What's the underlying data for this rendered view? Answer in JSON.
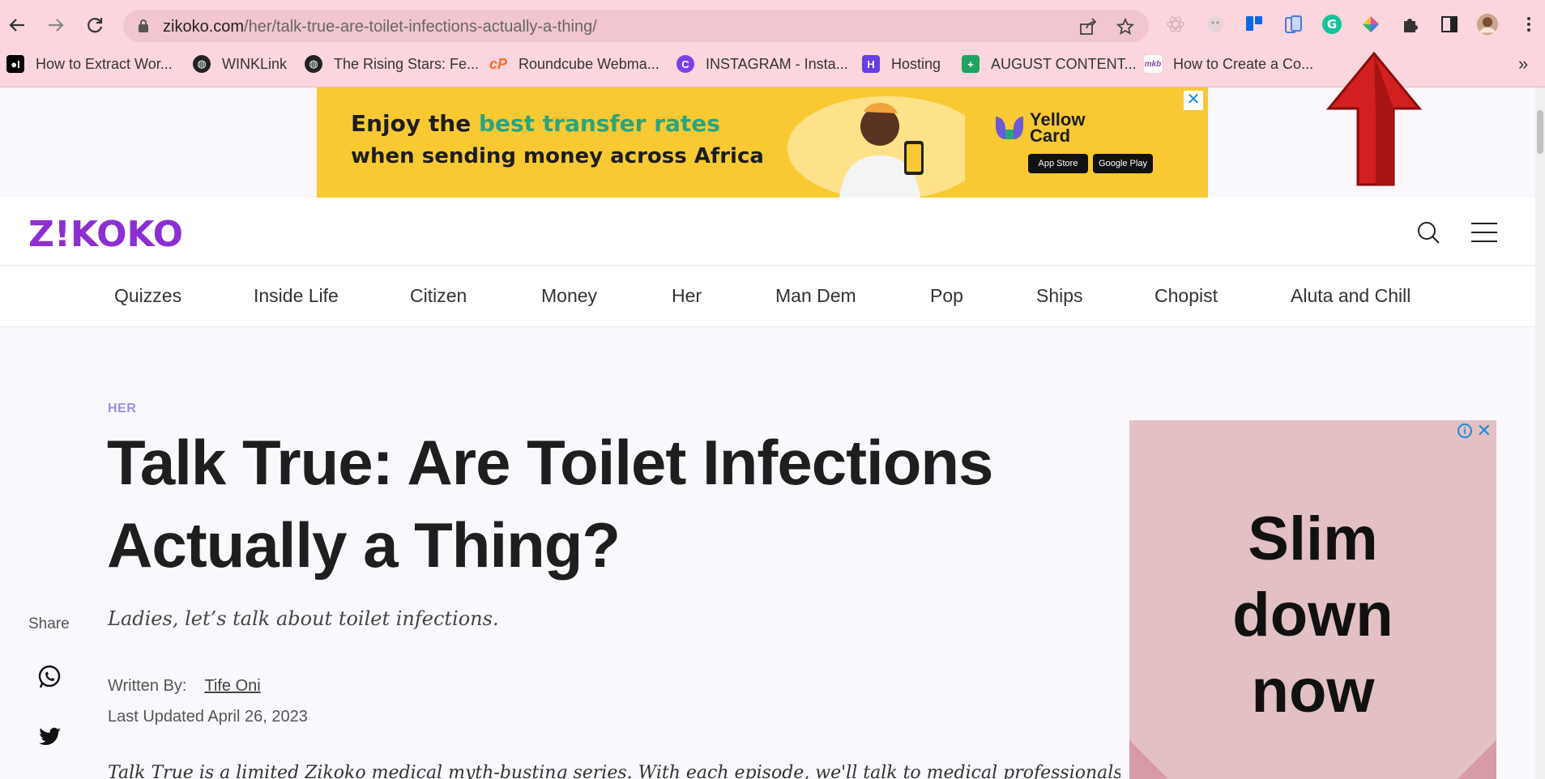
{
  "browser": {
    "url_host": "zikoko.com",
    "url_path": "/her/talk-true-are-toilet-infections-actually-a-thing/",
    "extensions": [
      "react-devtools-icon",
      "ghost-extension-icon",
      "trello-icon",
      "mobile-view-icon",
      "grammarly-icon",
      "color-picker-icon",
      "puzzle-icon",
      "side-panel-icon",
      "profile-avatar"
    ],
    "bookmarks": [
      {
        "label": "How to Extract Wor...",
        "icon": "medium-icon",
        "color": "#000000"
      },
      {
        "label": "WINKLink",
        "icon": "globe-icon",
        "color": "#222222"
      },
      {
        "label": "The Rising Stars: Fe...",
        "icon": "globe-icon",
        "color": "#222222"
      },
      {
        "label": "Roundcube Webma...",
        "icon": "cpanel-icon",
        "color": "#ff6c2c"
      },
      {
        "label": "INSTAGRAM - Insta...",
        "icon": "canva-icon",
        "color": "#7b3fe4"
      },
      {
        "label": "Hosting",
        "icon": "hostinger-icon",
        "color": "#673de6"
      },
      {
        "label": "AUGUST CONTENT...",
        "icon": "sheets-icon",
        "color": "#1ea362"
      },
      {
        "label": "How to Create a Co...",
        "icon": "mkb-icon",
        "color": "#ffffff"
      }
    ],
    "more_bookmarks": "»"
  },
  "top_ad": {
    "line1_a": "Enjoy the ",
    "line1_b": "best transfer rates",
    "line2": "when sending money across Africa",
    "brand": "Yellow Card",
    "store1": "App Store",
    "store2": "Google Play",
    "accent": "#2aa47b",
    "bg": "#f9c933"
  },
  "site": {
    "logo": "Z!KOKO",
    "brand_color": "#8d2fd0",
    "categories": [
      "Quizzes",
      "Inside Life",
      "Citizen",
      "Money",
      "Her",
      "Man Dem",
      "Pop",
      "Ships",
      "Chopist",
      "Aluta and Chill"
    ]
  },
  "article": {
    "kicker": "HER",
    "title_line1": "Talk True: Are Toilet Infections",
    "title_line2": "Actually a Thing?",
    "subtitle": "Ladies, let’s talk about toilet infections.",
    "written_by_label": "Written By:",
    "author": "Tife Oni",
    "updated": "Last Updated April 26, 2023",
    "body_peek": "Talk True is a limited Zikoko medical myth-busting series. With each episode, we'll talk to medical professionals"
  },
  "share": {
    "label": "Share"
  },
  "side_ad": {
    "text_line1": "Slim",
    "text_line2": "down",
    "text_line3": "now",
    "bg": "#e3c0c3"
  }
}
